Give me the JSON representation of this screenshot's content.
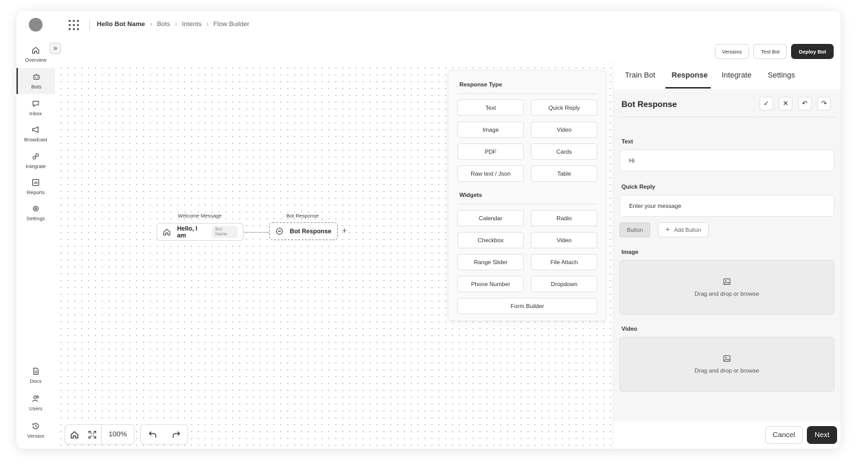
{
  "breadcrumb": {
    "bot_name": "Hello Bot Name",
    "items": [
      "Bots",
      "Intents",
      "Flow Builder"
    ]
  },
  "sidebar": {
    "items": [
      {
        "label": "Overview",
        "icon": "home-icon"
      },
      {
        "label": "Bots",
        "icon": "bot-icon",
        "active": true
      },
      {
        "label": "Inbox",
        "icon": "inbox-icon"
      },
      {
        "label": "Broadcast",
        "icon": "megaphone-icon"
      },
      {
        "label": "Integrate",
        "icon": "plug-icon"
      },
      {
        "label": "Reports",
        "icon": "chart-icon"
      },
      {
        "label": "Settings",
        "icon": "gear-icon"
      }
    ],
    "bottom_items": [
      {
        "label": "Docs",
        "icon": "doc-icon"
      },
      {
        "label": "Users",
        "icon": "users-icon"
      },
      {
        "label": "Version",
        "icon": "history-icon"
      }
    ]
  },
  "top_actions": {
    "versions": "Versions",
    "test_bot": "Test Bot",
    "deploy_bot": "Deploy Bot"
  },
  "flow": {
    "welcome": {
      "label": "Welcome Message",
      "text": "Hello, I am",
      "tag": "Bot Name"
    },
    "response": {
      "label": "Bot Response",
      "text": "Bot Response"
    }
  },
  "popover": {
    "response_type_title": "Response Type",
    "response_types": [
      "Text",
      "Quick Reply",
      "Image",
      "Video",
      "PDF",
      "Cards",
      "Raw text / Json",
      "Table"
    ],
    "widgets_title": "Widgets",
    "widgets": [
      "Calendar",
      "Radio",
      "Checkbox",
      "Video",
      "Range Slider",
      "File Attach",
      "Phone Number",
      "Dropdown"
    ],
    "form_builder": "Form Builder"
  },
  "toolbar": {
    "zoom": "100%"
  },
  "panel": {
    "tabs": [
      "Train Bot",
      "Response",
      "Integrate",
      "Settings"
    ],
    "active_tab": "Response",
    "title": "Bot Response",
    "text_label": "Text",
    "text_value": "Hi",
    "quick_reply_label": "Quick Reply",
    "quick_reply_placeholder": "Enter your message",
    "button_chip": "Button",
    "add_button": "Add Button",
    "image_label": "Image",
    "image_drop": "Drag and drop or browse",
    "video_label": "Video",
    "video_drop": "Drag and drop or browse",
    "cancel": "Cancel",
    "next": "Next"
  }
}
